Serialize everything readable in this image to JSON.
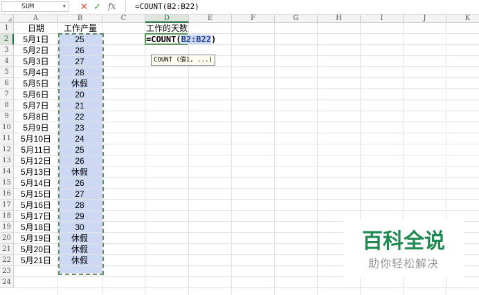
{
  "formula_bar": {
    "name_box": "SUM",
    "cancel_icon": "✕",
    "enter_icon": "✓",
    "fx_icon": "fx",
    "formula": "=COUNT(B2:B22)"
  },
  "columns": [
    "A",
    "B",
    "C",
    "D",
    "E",
    "F",
    "G",
    "H",
    "I",
    "J",
    "K"
  ],
  "rows": [
    "1",
    "2",
    "3",
    "4",
    "5",
    "6",
    "7",
    "8",
    "9",
    "10",
    "11",
    "12",
    "13",
    "14",
    "15",
    "16",
    "17",
    "18",
    "19",
    "20",
    "21",
    "22",
    "23",
    "24"
  ],
  "headers": {
    "a1": "日期",
    "b1": "工作产量",
    "d1": "工作的天数"
  },
  "table": [
    {
      "date": "5月1日",
      "value": "25"
    },
    {
      "date": "5月2日",
      "value": "26"
    },
    {
      "date": "5月3日",
      "value": "27"
    },
    {
      "date": "5月4日",
      "value": "28"
    },
    {
      "date": "5月5日",
      "value": "休假"
    },
    {
      "date": "5月6日",
      "value": "20"
    },
    {
      "date": "5月7日",
      "value": "21"
    },
    {
      "date": "5月8日",
      "value": "22"
    },
    {
      "date": "5月9日",
      "value": "23"
    },
    {
      "date": "5月10日",
      "value": "24"
    },
    {
      "date": "5月11日",
      "value": "25"
    },
    {
      "date": "5月12日",
      "value": "26"
    },
    {
      "date": "5月13日",
      "value": "休假"
    },
    {
      "date": "5月14日",
      "value": "26"
    },
    {
      "date": "5月15日",
      "value": "27"
    },
    {
      "date": "5月16日",
      "value": "28"
    },
    {
      "date": "5月17日",
      "value": "29"
    },
    {
      "date": "5月18日",
      "value": "30"
    },
    {
      "date": "5月19日",
      "value": "休假"
    },
    {
      "date": "5月20日",
      "value": "休假"
    },
    {
      "date": "5月21日",
      "value": "休假"
    }
  ],
  "editing": {
    "prefix": "=COUNT(",
    "ref": "B2:B22",
    "suffix": ")",
    "tooltip": "COUNT (值1, ...)"
  },
  "watermark": {
    "title": "百科全说",
    "subtitle": "助你轻松解决"
  },
  "colors": {
    "accent": "#217346",
    "range_fill": "#cdd8f3",
    "watermark": "#1f8a52"
  }
}
